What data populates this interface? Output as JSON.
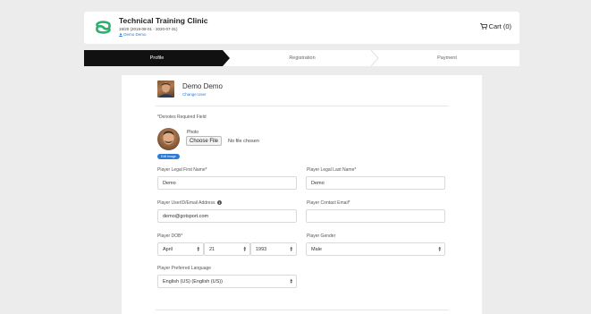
{
  "header": {
    "club_name": "Technical Training Clinic",
    "season": "19/20 (2019-08-01 - 2020-07-31)",
    "user_link": "Demo Demo",
    "cart_label": "Cart (0)"
  },
  "steps": [
    {
      "label": "Profile",
      "active": true
    },
    {
      "label": "Registration",
      "active": false
    },
    {
      "label": "Payment",
      "active": false
    }
  ],
  "user": {
    "name": "Demo Demo",
    "change_user": "Change User"
  },
  "form": {
    "required_note": "*Denotes Required Field",
    "photo_label": "Photo",
    "choose_file": "Choose File",
    "no_file": "No file chosen",
    "edit_image": "Edit Image",
    "first_name_label": "Player Legal First Name*",
    "first_name_value": "Demo",
    "last_name_label": "Player Legal Last Name*",
    "last_name_value": "Demo",
    "email_label": "Player UserID/Email Address",
    "email_value": "demo@gotsport.com",
    "contact_email_label": "Player Contact Email*",
    "contact_email_value": "",
    "dob_label": "Player DOB*",
    "dob_month": "April",
    "dob_day": "21",
    "dob_year": "1993",
    "gender_label": "Player Gender",
    "gender_value": "Male",
    "language_label": "Player Preferred Language",
    "language_value": "English (US) (English (US))"
  },
  "colors": {
    "accent": "#2a7bd6",
    "logo": "#2fae6e",
    "active_step": "#111111"
  },
  "icons": {
    "logo": "club-logo-icon",
    "cart": "cart-icon",
    "user": "user-icon",
    "info": "info-icon",
    "select_caret": "select-caret-icon"
  }
}
